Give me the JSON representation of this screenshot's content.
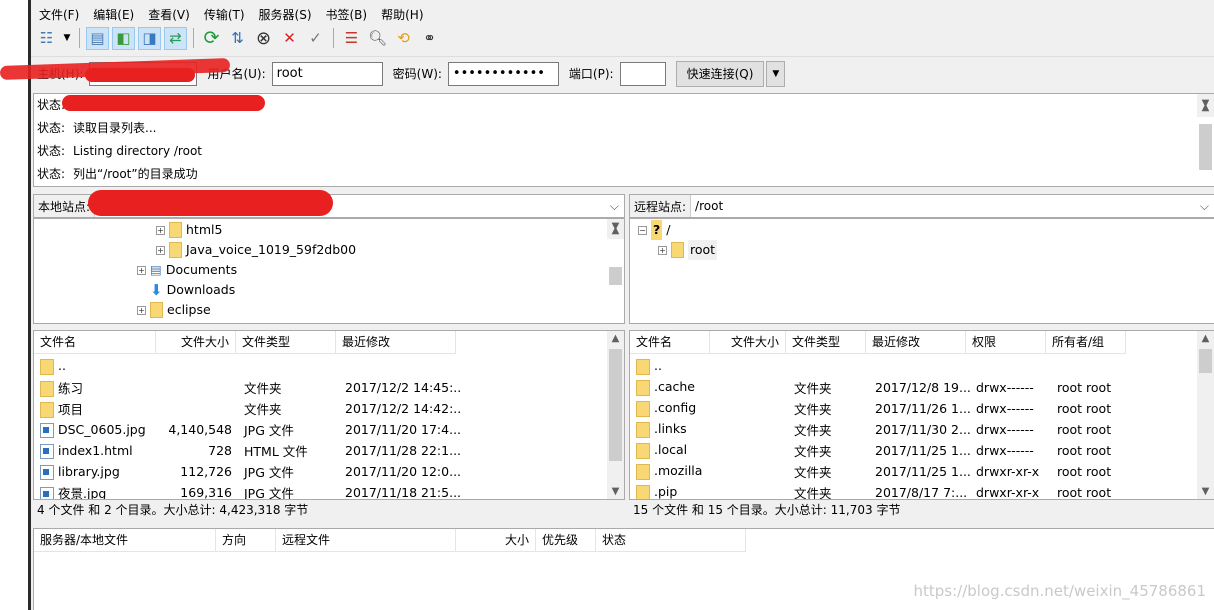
{
  "menu": [
    "文件(F)",
    "编辑(E)",
    "查看(V)",
    "传输(T)",
    "服务器(S)",
    "书签(B)",
    "帮助(H)"
  ],
  "toolbar": [
    {
      "icon": "site-manager-icon"
    },
    {
      "icon": "dropdown-icon"
    },
    {
      "icon": "toggle-log-icon",
      "active": true
    },
    {
      "icon": "toggle-local-tree-icon",
      "active": true
    },
    {
      "icon": "toggle-remote-tree-icon",
      "active": true
    },
    {
      "icon": "toggle-queue-icon",
      "active": true
    },
    {
      "icon": "refresh-icon"
    },
    {
      "icon": "process-queue-icon"
    },
    {
      "icon": "cancel-icon"
    },
    {
      "icon": "disconnect-icon"
    },
    {
      "icon": "reconnect-icon"
    },
    {
      "icon": "filter-icon"
    },
    {
      "icon": "compare-icon"
    },
    {
      "icon": "sync-browse-icon"
    },
    {
      "icon": "search-icon"
    }
  ],
  "quickconnect": {
    "host_label": "主机(H):",
    "host_value": "",
    "user_label": "用户名(U):",
    "user_value": "root",
    "pass_label": "密码(W):",
    "pass_value": "••••••••••••",
    "port_label": "端口(P):",
    "port_value": "",
    "connect_label": "快速连接(Q)"
  },
  "log": [
    {
      "k": "状态:",
      "v": ""
    },
    {
      "k": "状态:",
      "v": "读取目录列表..."
    },
    {
      "k": "状态:",
      "v": "Listing directory /root"
    },
    {
      "k": "状态:",
      "v": "列出“/root”的目录成功"
    }
  ],
  "local": {
    "site_label": "本地站点:",
    "site_value": "",
    "tree": [
      "html5",
      "Java_voice_1019_59f2db00",
      "Documents",
      "Downloads",
      "eclipse"
    ],
    "columns": [
      "文件名",
      "文件大小",
      "文件类型",
      "最近修改"
    ],
    "files": [
      [
        "..",
        "",
        "",
        ""
      ],
      [
        "练习",
        "",
        "文件夹",
        "2017/12/2 14:45:..."
      ],
      [
        "项目",
        "",
        "文件夹",
        "2017/12/2 14:42:..."
      ],
      [
        "DSC_0605.jpg",
        "4,140,548",
        "JPG 文件",
        "2017/11/20 17:4..."
      ],
      [
        "index1.html",
        "728",
        "HTML 文件",
        "2017/11/28 22:1..."
      ],
      [
        "library.jpg",
        "112,726",
        "JPG 文件",
        "2017/11/20 12:0..."
      ],
      [
        "夜景.jpg",
        "169,316",
        "JPG 文件",
        "2017/11/18 21:5..."
      ]
    ],
    "status": "4 个文件 和 2 个目录。大小总计: 4,423,318 字节"
  },
  "remote": {
    "site_label": "远程站点:",
    "site_value": "/root",
    "tree": [
      "/",
      "root"
    ],
    "columns": [
      "文件名",
      "文件大小",
      "文件类型",
      "最近修改",
      "权限",
      "所有者/组"
    ],
    "files": [
      [
        "..",
        "",
        "",
        "",
        "",
        ""
      ],
      [
        ".cache",
        "",
        "文件夹",
        "2017/12/8 19...",
        "drwx------",
        "root root"
      ],
      [
        ".config",
        "",
        "文件夹",
        "2017/11/26 1...",
        "drwx------",
        "root root"
      ],
      [
        ".links",
        "",
        "文件夹",
        "2017/11/30 2...",
        "drwx------",
        "root root"
      ],
      [
        ".local",
        "",
        "文件夹",
        "2017/11/25 1...",
        "drwx------",
        "root root"
      ],
      [
        ".mozilla",
        "",
        "文件夹",
        "2017/11/25 1...",
        "drwxr-xr-x",
        "root root"
      ],
      [
        ".pip",
        "",
        "文件夹",
        "2017/8/17 7:...",
        "drwxr-xr-x",
        "root root"
      ]
    ],
    "status": "15 个文件 和 15 个目录。大小总计: 11,703 字节"
  },
  "queue": {
    "columns": [
      "服务器/本地文件",
      "方向",
      "远程文件",
      "大小",
      "优先级",
      "状态"
    ]
  },
  "watermark": "https://blog.csdn.net/weixin_45786861"
}
